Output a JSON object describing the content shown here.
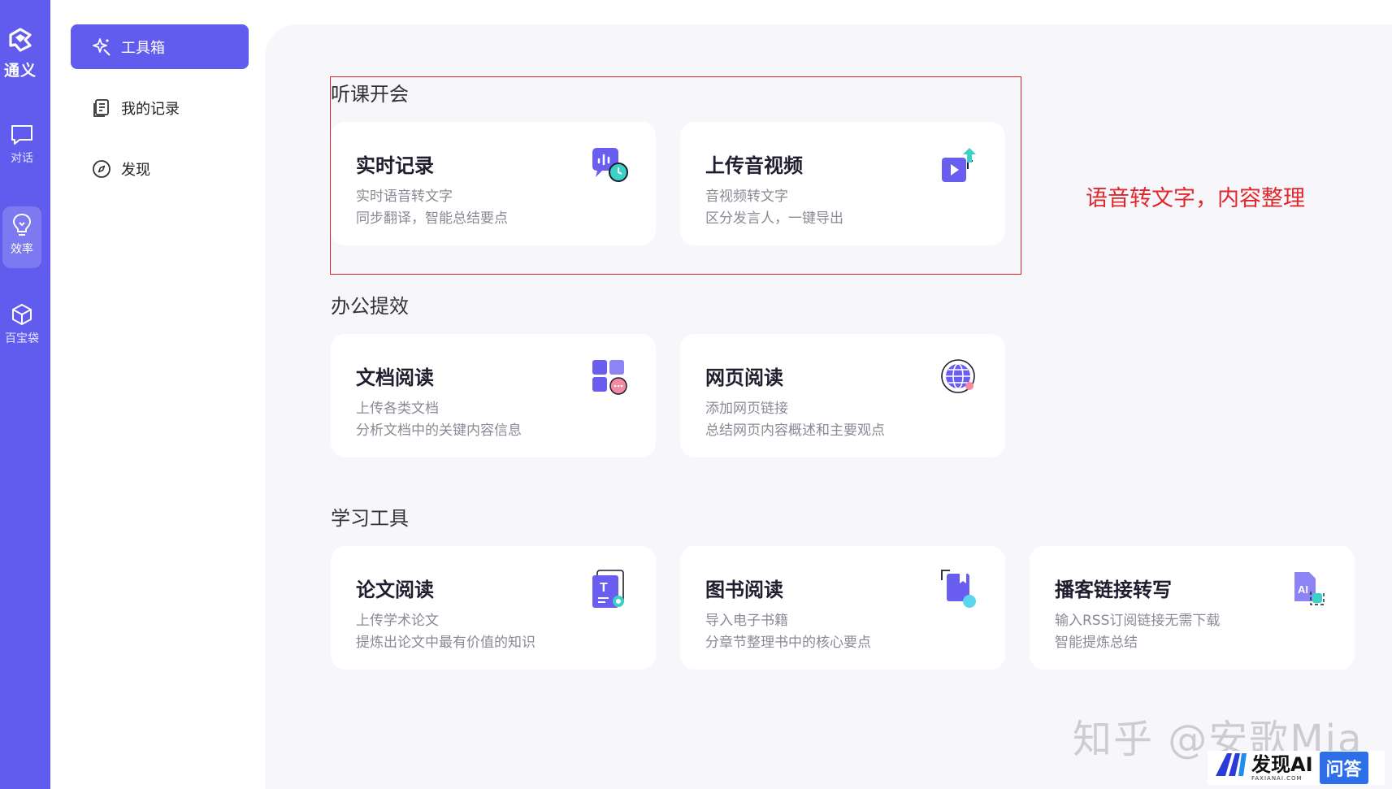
{
  "rail": {
    "brand": "通义",
    "items": [
      {
        "label": "对话",
        "icon": "chat-bubble-icon"
      },
      {
        "label": "效率",
        "icon": "lightbulb-icon"
      },
      {
        "label": "百宝袋",
        "icon": "cube-icon"
      }
    ]
  },
  "sidenav": {
    "items": [
      {
        "label": "工具箱",
        "icon": "sparkle-tool-icon"
      },
      {
        "label": "我的记录",
        "icon": "document-list-icon"
      },
      {
        "label": "发现",
        "icon": "compass-icon"
      }
    ]
  },
  "sections": [
    {
      "title": "听课开会",
      "cards": [
        {
          "title": "实时记录",
          "line1": "实时语音转文字",
          "line2": "同步翻译，智能总结要点",
          "icon": "realtime-record-icon"
        },
        {
          "title": "上传音视频",
          "line1": "音视频转文字",
          "line2": "区分发言人，一键导出",
          "icon": "upload-video-icon"
        }
      ]
    },
    {
      "title": "办公提效",
      "cards": [
        {
          "title": "文档阅读",
          "line1": "上传各类文档",
          "line2": "分析文档中的关键内容信息",
          "icon": "document-read-icon"
        },
        {
          "title": "网页阅读",
          "line1": "添加网页链接",
          "line2": "总结网页内容概述和主要观点",
          "icon": "globe-icon"
        }
      ]
    },
    {
      "title": "学习工具",
      "cards": [
        {
          "title": "论文阅读",
          "line1": "上传学术论文",
          "line2": "提炼出论文中最有价值的知识",
          "icon": "paper-read-icon"
        },
        {
          "title": "图书阅读",
          "line1": "导入电子书籍",
          "line2": "分章节整理书中的核心要点",
          "icon": "book-icon"
        },
        {
          "title": "播客链接转写",
          "line1": "输入RSS订阅链接无需下载",
          "line2": "智能提炼总结",
          "icon": "podcast-ai-icon"
        }
      ]
    }
  ],
  "annotation": "语音转文字，内容整理",
  "watermark": "知乎 @安歌Mia",
  "badge": {
    "name": "发现AI",
    "sub": "FAXIANAI.COM",
    "qa": "问答"
  },
  "colors": {
    "accent": "#615ced",
    "annotation": "#e0272c"
  }
}
